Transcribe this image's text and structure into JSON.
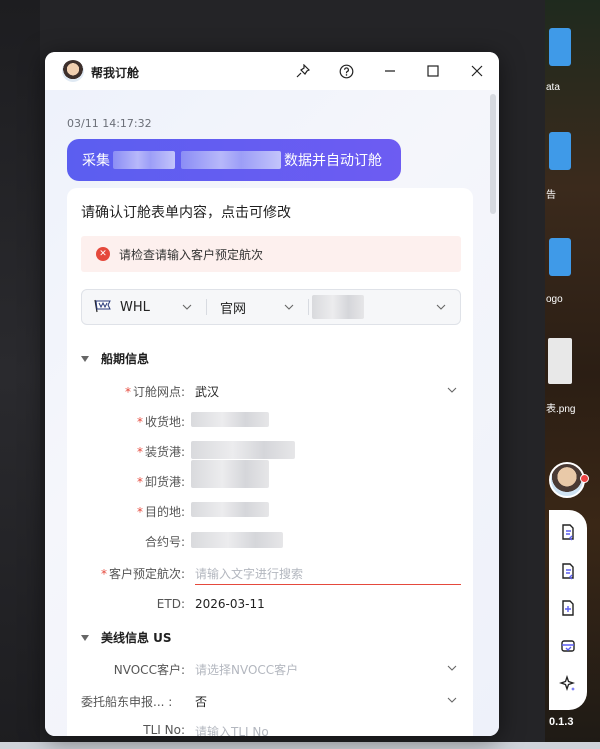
{
  "desktop": {
    "labels": [
      "ata",
      "告",
      "ogo",
      "表.png"
    ],
    "version": "0.1.3"
  },
  "window": {
    "title": "帮我订舱",
    "buttons": [
      "pin-icon",
      "help-icon",
      "minimize-icon",
      "maximize-icon",
      "close-icon"
    ]
  },
  "chat": {
    "timestamp": "03/11 14:17:32",
    "request_prefix": "采集",
    "request_suffix": "数据并自动订舱"
  },
  "form": {
    "heading": "请确认订舱表单内容，点击可修改",
    "alert": "请检查请输入客户预定航次",
    "carrier": "WHL",
    "channel": "官网",
    "section_schedule": "船期信息",
    "section_us": "美线信息 US",
    "fields": {
      "booking_office": {
        "label": "订舱网点",
        "value": "武汉"
      },
      "receipt": {
        "label": "收货地"
      },
      "loading_port": {
        "label": "装货港"
      },
      "discharge_port": {
        "label": "卸货港"
      },
      "destination": {
        "label": "目的地"
      },
      "contract": {
        "label": "合约号"
      },
      "voyage": {
        "label": "客户预定航次",
        "placeholder": "请输入文字进行搜索"
      },
      "etd": {
        "label": "ETD",
        "value": "2026-03-11"
      },
      "nvocc": {
        "label": "NVOCC客户",
        "placeholder": "请选择NVOCC客户"
      },
      "owner_declare": {
        "label": "委托船东申报...",
        "value": "否"
      },
      "tli": {
        "label": "TLI No",
        "placeholder": "请输入TLI No"
      }
    }
  }
}
